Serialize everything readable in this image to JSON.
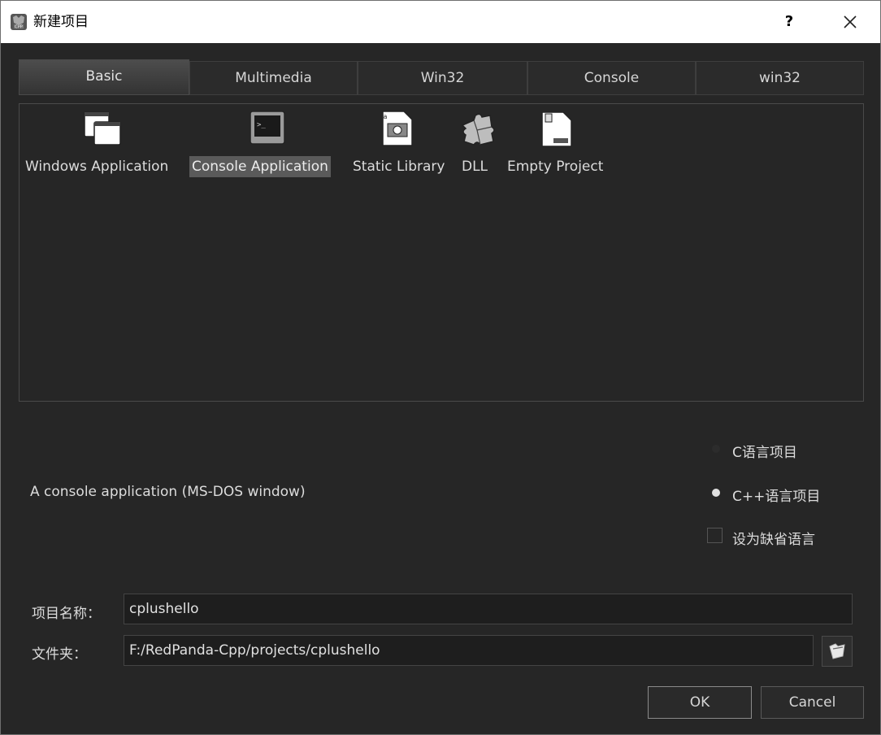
{
  "window": {
    "title": "新建项目",
    "help_label": "?",
    "icon": "redpanda-icon",
    "close_icon": "close-icon"
  },
  "tabs": [
    {
      "label": "Basic",
      "active": true
    },
    {
      "label": "Multimedia",
      "active": false
    },
    {
      "label": "Win32",
      "active": false
    },
    {
      "label": "Console",
      "active": false
    },
    {
      "label": "win32",
      "active": false
    }
  ],
  "templates": [
    {
      "label": "Windows Application",
      "icon": "windows-app-icon",
      "selected": false
    },
    {
      "label": "Console Application",
      "icon": "console-app-icon",
      "selected": true
    },
    {
      "label": "Static Library",
      "icon": "static-library-icon",
      "selected": false
    },
    {
      "label": "DLL",
      "icon": "dll-puzzle-icon",
      "selected": false
    },
    {
      "label": "Empty Project",
      "icon": "empty-project-icon",
      "selected": false
    }
  ],
  "description": "A console application (MS-DOS window)",
  "language": {
    "c_label": "C语言项目",
    "cpp_label": "C++语言项目",
    "selected": "cpp",
    "default_label": "设为缺省语言",
    "default_checked": false
  },
  "project_name": {
    "label": "项目名称：",
    "value": "cplushello"
  },
  "folder": {
    "label": "文件夹：",
    "value": "F:/RedPanda-Cpp/projects/cplushello",
    "browse_icon": "folder-browse-icon"
  },
  "buttons": {
    "ok": "OK",
    "cancel": "Cancel"
  },
  "colors": {
    "background": "#262626",
    "titlebar": "#ffffff",
    "selection": "#5a5a5a",
    "text": "#dcdcdc"
  }
}
